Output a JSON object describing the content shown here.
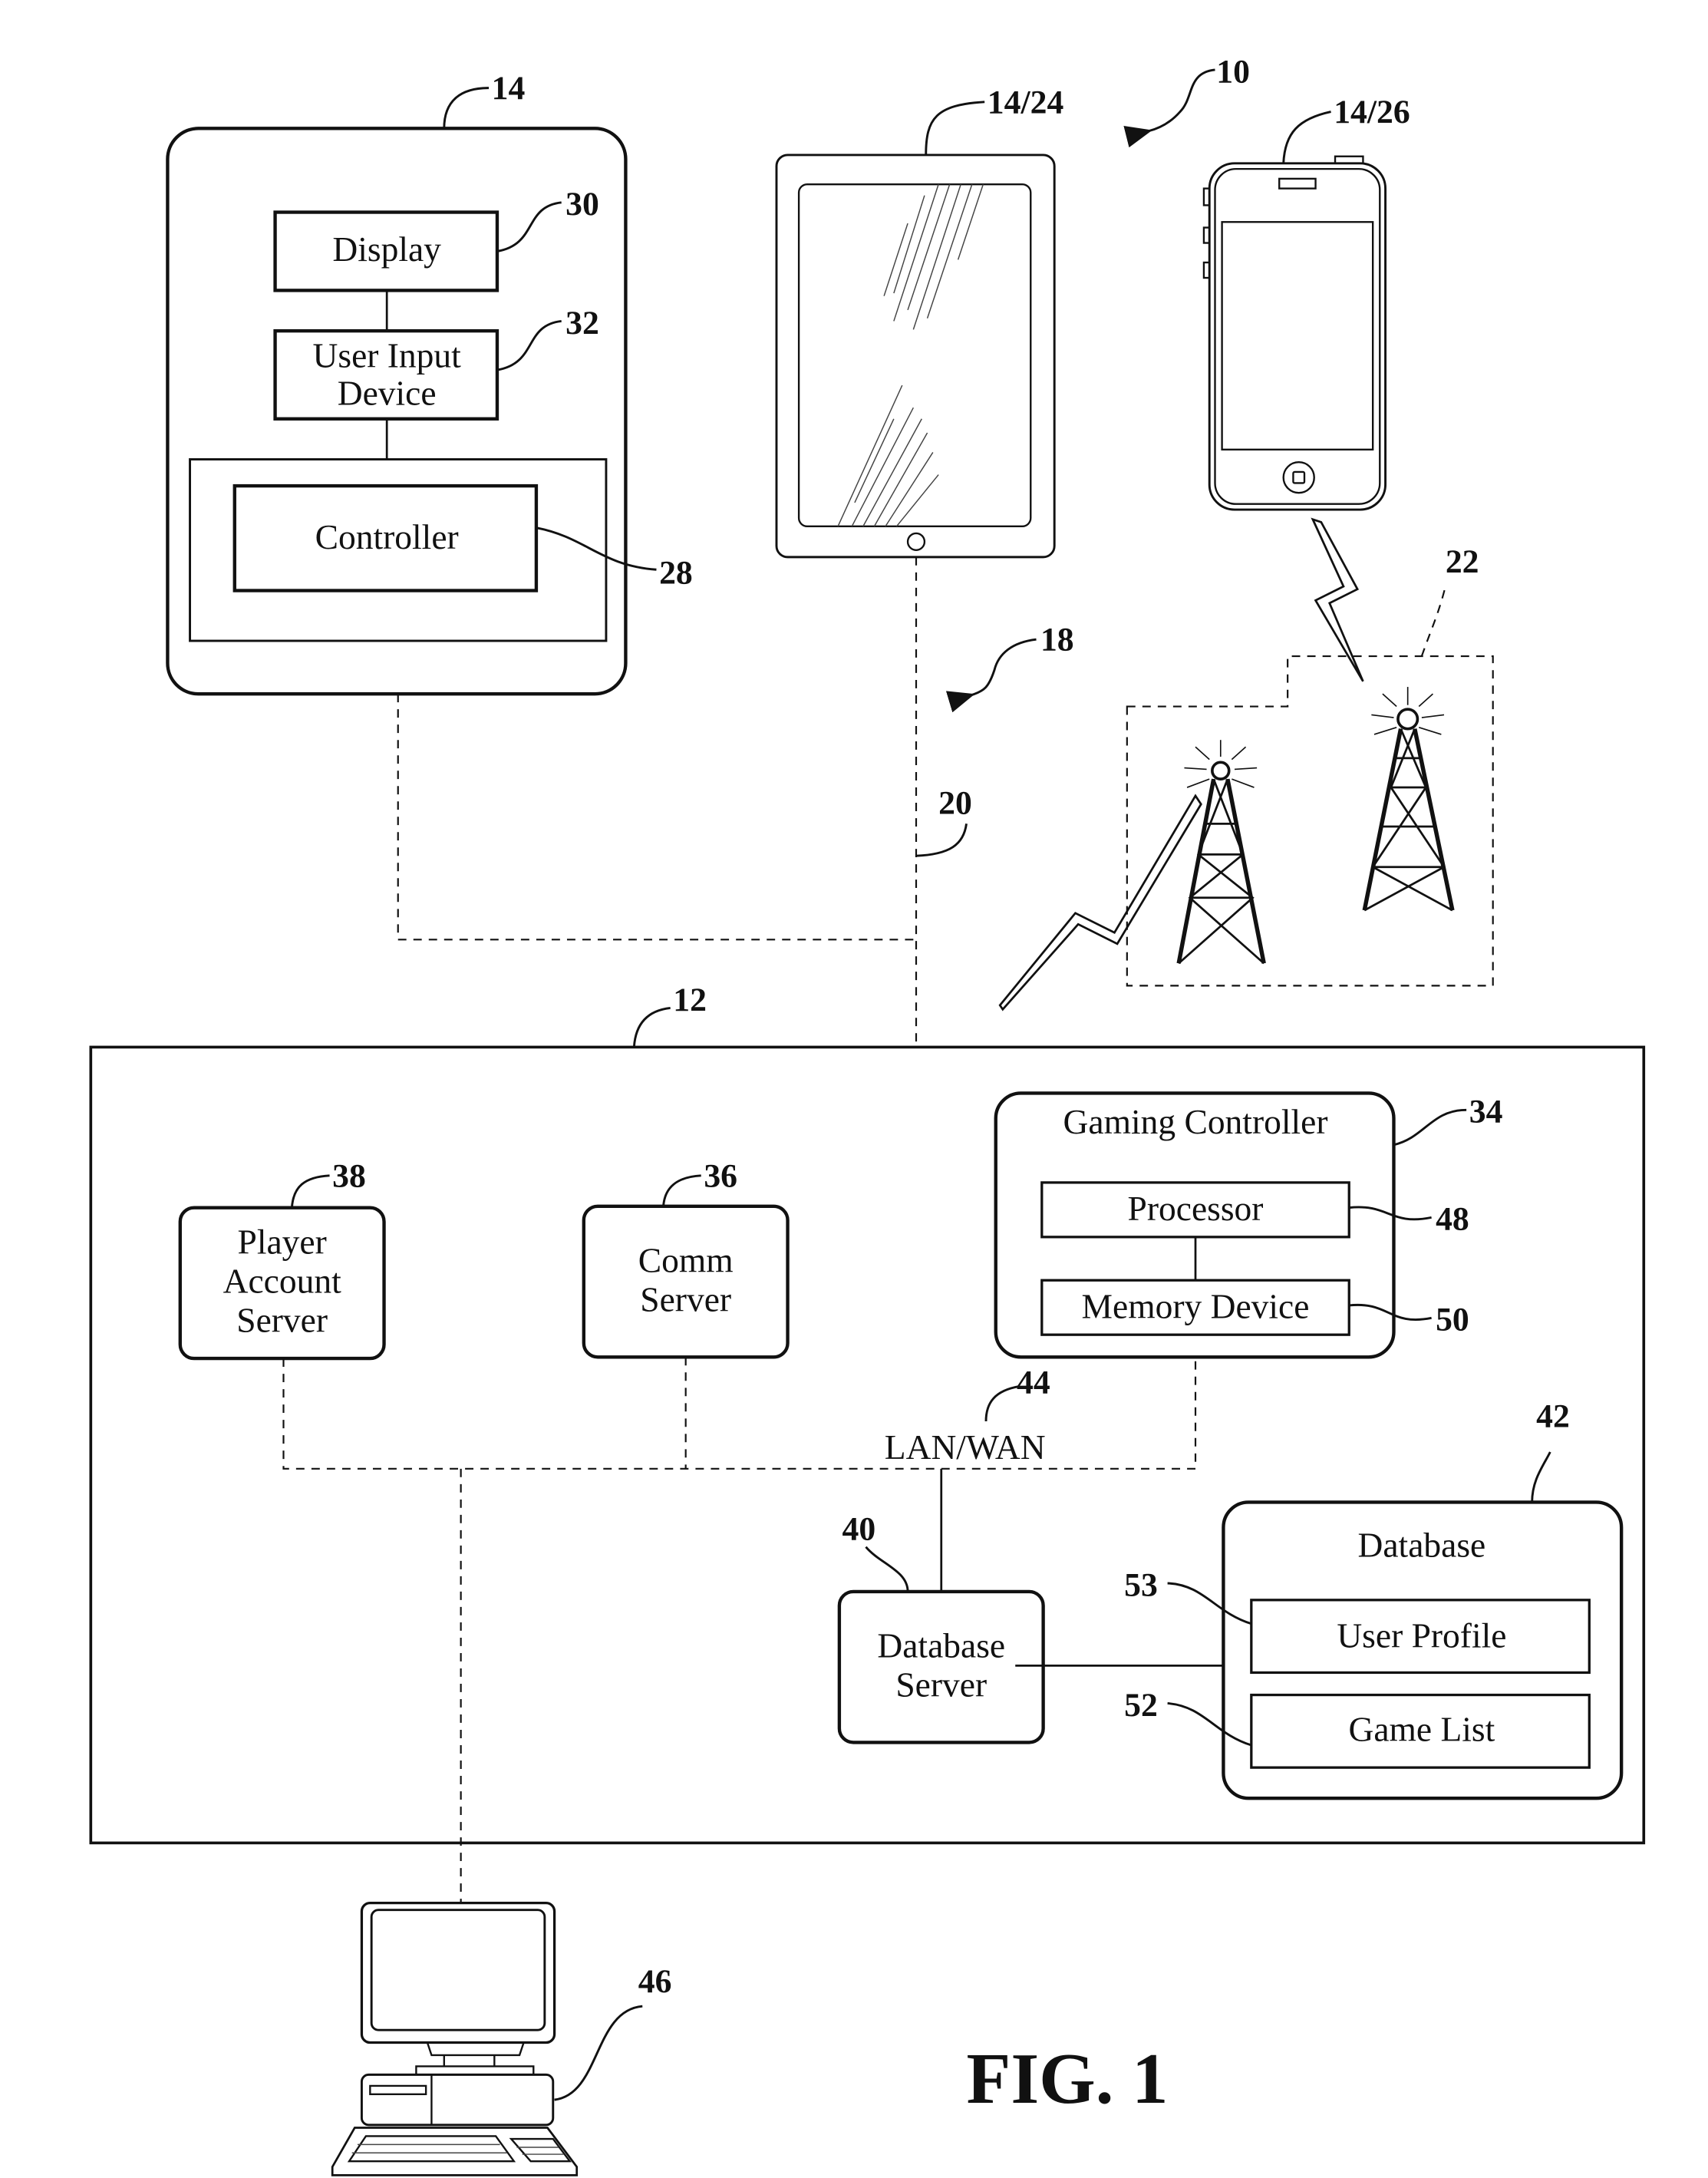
{
  "figure": {
    "title": "FIG. 1",
    "system_ref": "10",
    "network_ref": "18",
    "connection_ref": "20",
    "cellular_ref": "22"
  },
  "user_device": {
    "ref": "14",
    "components": [
      {
        "label_lines": [
          "Display"
        ],
        "ref": "30"
      },
      {
        "label_lines": [
          "User Input",
          "Device"
        ],
        "ref": "32"
      },
      {
        "label_lines": [
          "Controller"
        ],
        "ref": "28"
      }
    ]
  },
  "tablet": {
    "ref": "14/24"
  },
  "phone": {
    "ref": "14/26"
  },
  "server_system": {
    "ref": "12",
    "network_label": "LAN/WAN",
    "network_ref": "44",
    "player_account_server": {
      "label_lines": [
        "Player",
        "Account",
        "Server"
      ],
      "ref": "38"
    },
    "comm_server": {
      "label_lines": [
        "Comm",
        "Server"
      ],
      "ref": "36"
    },
    "gaming_controller": {
      "title": "Gaming Controller",
      "ref": "34",
      "processor": {
        "label": "Processor",
        "ref": "48"
      },
      "memory": {
        "label": "Memory Device",
        "ref": "50"
      }
    },
    "database_server": {
      "label_lines": [
        "Database",
        "Server"
      ],
      "ref": "40"
    },
    "database": {
      "title": "Database",
      "ref": "42",
      "user_profile": {
        "label": "User Profile",
        "ref": "53"
      },
      "game_list": {
        "label": "Game List",
        "ref": "52"
      }
    }
  },
  "computer": {
    "ref": "46"
  }
}
